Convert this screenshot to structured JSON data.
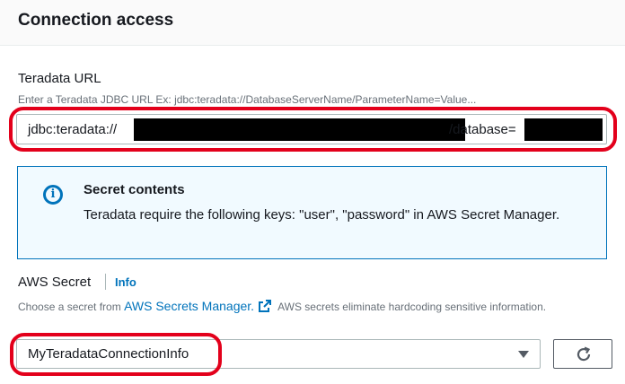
{
  "panel": {
    "title": "Connection access"
  },
  "teradata_url": {
    "label": "Teradata URL",
    "description": "Enter a Teradata JDBC URL Ex: jdbc:teradata://DatabaseServerName/ParameterName=Value...",
    "value_prefix": "jdbc:teradata://",
    "value_middle": "/database="
  },
  "secret_info": {
    "icon": "info-icon",
    "title": "Secret contents",
    "body": "Teradata require the following keys: \"user\", \"password\" in AWS Secret Manager."
  },
  "aws_secret": {
    "label": "AWS Secret",
    "info_link": "Info",
    "description_prefix": "Choose a secret from",
    "manager_link": "AWS Secrets Manager.",
    "description_suffix": "AWS secrets eliminate hardcoding sensitive information.",
    "selected_value": "MyTeradataConnectionInfo"
  },
  "colors": {
    "highlight": "#e3001b",
    "link": "#0073bb",
    "info_bg": "#f1faff"
  }
}
